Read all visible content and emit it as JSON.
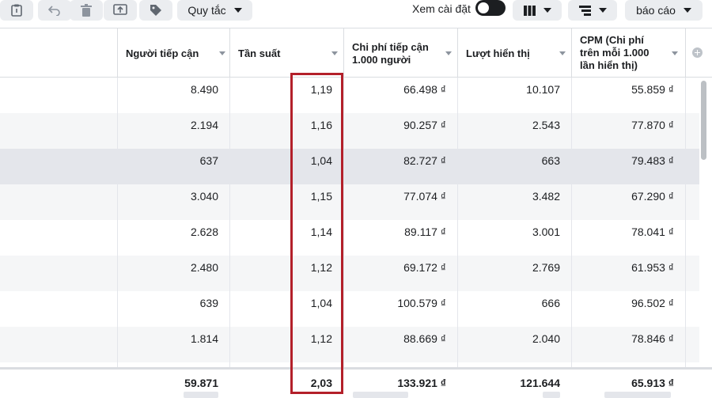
{
  "toolbar": {
    "rules_label": "Quy tắc",
    "view_settings_label": "Xem cài đặt",
    "report_label": "báo cáo"
  },
  "columns": [
    {
      "label": "Người tiếp cận"
    },
    {
      "label": "Tần suất"
    },
    {
      "label": "Chi phí tiếp cận 1.000 người"
    },
    {
      "label": "Lượt hiển thị"
    },
    {
      "label": "CPM (Chi phí trên mỗi 1.000 lần hiển thị)"
    }
  ],
  "rows": [
    {
      "reach": "8.490",
      "frequency": "1,19",
      "cost_per_1000_reach": "66.498 ₫",
      "impressions": "10.107",
      "cpm": "55.859 ₫"
    },
    {
      "reach": "2.194",
      "frequency": "1,16",
      "cost_per_1000_reach": "90.257 ₫",
      "impressions": "2.543",
      "cpm": "77.870 ₫"
    },
    {
      "reach": "637",
      "frequency": "1,04",
      "cost_per_1000_reach": "82.727 ₫",
      "impressions": "663",
      "cpm": "79.483 ₫"
    },
    {
      "reach": "3.040",
      "frequency": "1,15",
      "cost_per_1000_reach": "77.074 ₫",
      "impressions": "3.482",
      "cpm": "67.290 ₫"
    },
    {
      "reach": "2.628",
      "frequency": "1,14",
      "cost_per_1000_reach": "89.117 ₫",
      "impressions": "3.001",
      "cpm": "78.041 ₫"
    },
    {
      "reach": "2.480",
      "frequency": "1,12",
      "cost_per_1000_reach": "69.172 ₫",
      "impressions": "2.769",
      "cpm": "61.953 ₫"
    },
    {
      "reach": "639",
      "frequency": "1,04",
      "cost_per_1000_reach": "100.579 ₫",
      "impressions": "666",
      "cpm": "96.502 ₫"
    },
    {
      "reach": "1.814",
      "frequency": "1,12",
      "cost_per_1000_reach": "88.669 ₫",
      "impressions": "2.040",
      "cpm": "78.846 ₫"
    }
  ],
  "totals": {
    "reach": "59.871",
    "frequency": "2,03",
    "cost_per_1000_reach": "133.921 ₫",
    "impressions": "121.644",
    "cpm": "65.913 ₫"
  },
  "colors": {
    "highlight_border": "#b3202a",
    "toolbar_button_bg": "#ebedf0",
    "row_alt": "#f5f6f7",
    "row_selected": "#e4e6eb"
  },
  "state": {
    "view_settings_toggle": "off",
    "highlighted_column": "Tần suất"
  }
}
